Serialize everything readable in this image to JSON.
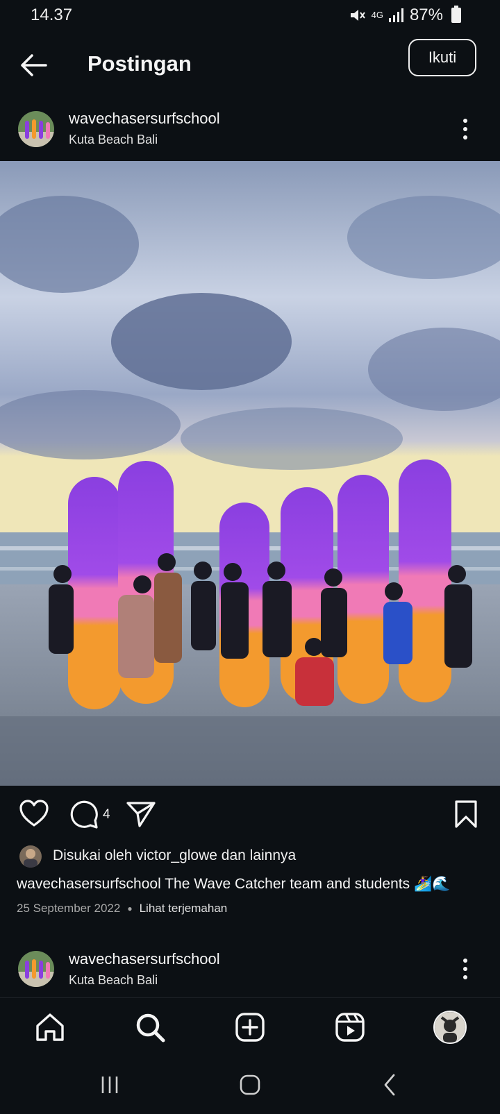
{
  "status_bar": {
    "time": "14.37",
    "network": "4G",
    "battery": "87%"
  },
  "header": {
    "title": "Postingan",
    "follow_label": "Ikuti"
  },
  "post": {
    "username": "wavechasersurfschool",
    "location": "Kuta Beach Bali",
    "comment_count": "4",
    "liked_by_text": "Disukai oleh victor_glowe dan lainnya",
    "caption": "wavechasersurfschool The Wave Catcher team and students 🏄‍♀️🌊",
    "date": "25 September 2022",
    "translate_label": "Lihat terjemahan"
  },
  "next_post": {
    "username": "wavechasersurfschool",
    "location": "Kuta Beach Bali"
  },
  "bottom_nav": {
    "items": [
      "home-icon",
      "search-icon",
      "create-icon",
      "reels-icon",
      "profile-avatar"
    ]
  },
  "colors": {
    "background": "#0c1014",
    "board_purple": "#8a3fe0",
    "board_pink": "#f07ab6",
    "board_orange": "#f39a2e"
  }
}
